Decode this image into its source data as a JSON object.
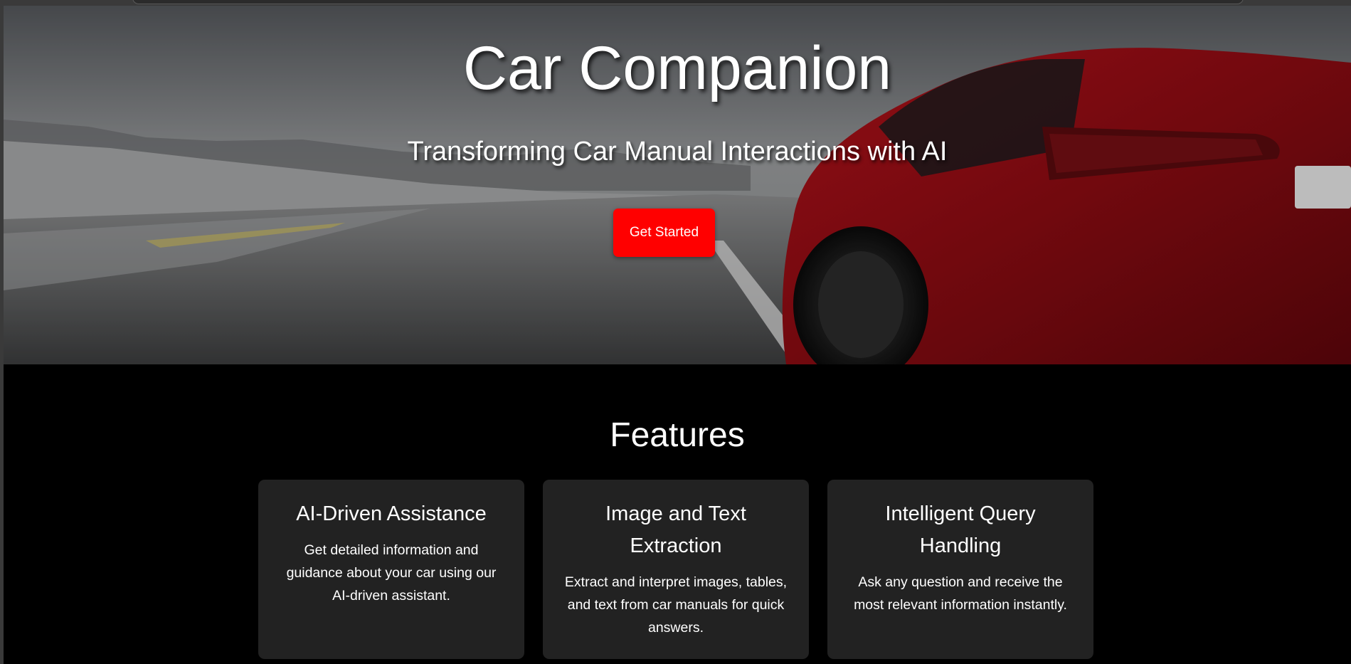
{
  "hero": {
    "title": "Car Companion",
    "subtitle": "Transforming Car Manual Interactions with AI",
    "cta_label": "Get Started"
  },
  "features": {
    "heading": "Features",
    "cards": [
      {
        "title": "AI-Driven Assistance",
        "description": "Get detailed information and guidance about your car using our AI-driven assistant."
      },
      {
        "title": "Image and Text Extraction",
        "description": "Extract and interpret images, tables, and text from car manuals for quick answers."
      },
      {
        "title": "Intelligent Query Handling",
        "description": "Ask any question and receive the most relevant information instantly."
      }
    ]
  },
  "colors": {
    "accent": "#ff0000",
    "page_background": "#000000",
    "card_background": "#222222",
    "text": "#ffffff"
  }
}
